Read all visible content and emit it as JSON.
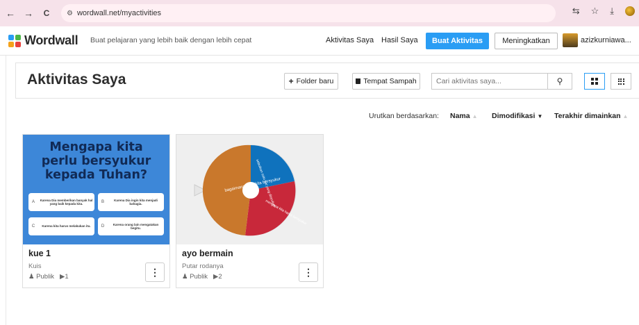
{
  "browser": {
    "url": "wordwall.net/myactivities",
    "nav_back": "←",
    "nav_forward": "→",
    "nav_reload": "C"
  },
  "header": {
    "logo_text": "Wordwall",
    "tagline": "Buat pelajaran yang lebih baik dengan lebih cepat",
    "nav_my_activities": "Aktivitas Saya",
    "nav_my_results": "Hasil Saya",
    "create_label": "Buat Aktivitas",
    "upgrade_label": "Meningkatkan",
    "username": "azizkurniawa...",
    "accent_color": "#2a9df4"
  },
  "toolbar": {
    "page_title": "Aktivitas Saya",
    "new_folder_label": "Folder baru",
    "trash_label": "Tempat Sampah",
    "search_placeholder": "Cari aktivitas saya..."
  },
  "sort": {
    "label": "Urutkan berdasarkan:",
    "options": [
      "Nama",
      "Dimodifikasi",
      "Terakhir dimainkan"
    ],
    "active": "Dimodifikasi"
  },
  "cards": [
    {
      "name": "kue 1",
      "type": "Kuis",
      "visibility": "Publik",
      "plays": "1",
      "thumb": {
        "title_line1": "Mengapa kita",
        "title_line2": "perlu bersyukur",
        "title_line3": "kepada Tuhan?",
        "options": [
          {
            "letter": "A",
            "text": "Karena Dia memberikan banyak hal yang baik kepada kita."
          },
          {
            "letter": "B",
            "text": "Karena Dia ingin kita menjadi bahagia."
          },
          {
            "letter": "C",
            "text": "Karena kita harus melakukan itu."
          },
          {
            "letter": "D",
            "text": "Karena orang lain mengatakan begitu."
          }
        ]
      }
    },
    {
      "name": "ayo bermain",
      "type": "Putar rodanya",
      "visibility": "Publik",
      "plays": "2",
      "thumb": {
        "segment_left": "bagaimana cara kita bersyukur",
        "segment_top": "sebutkan satu hal yang disyukuri",
        "segment_right": "mengapa kita harus bersyukur"
      }
    }
  ]
}
